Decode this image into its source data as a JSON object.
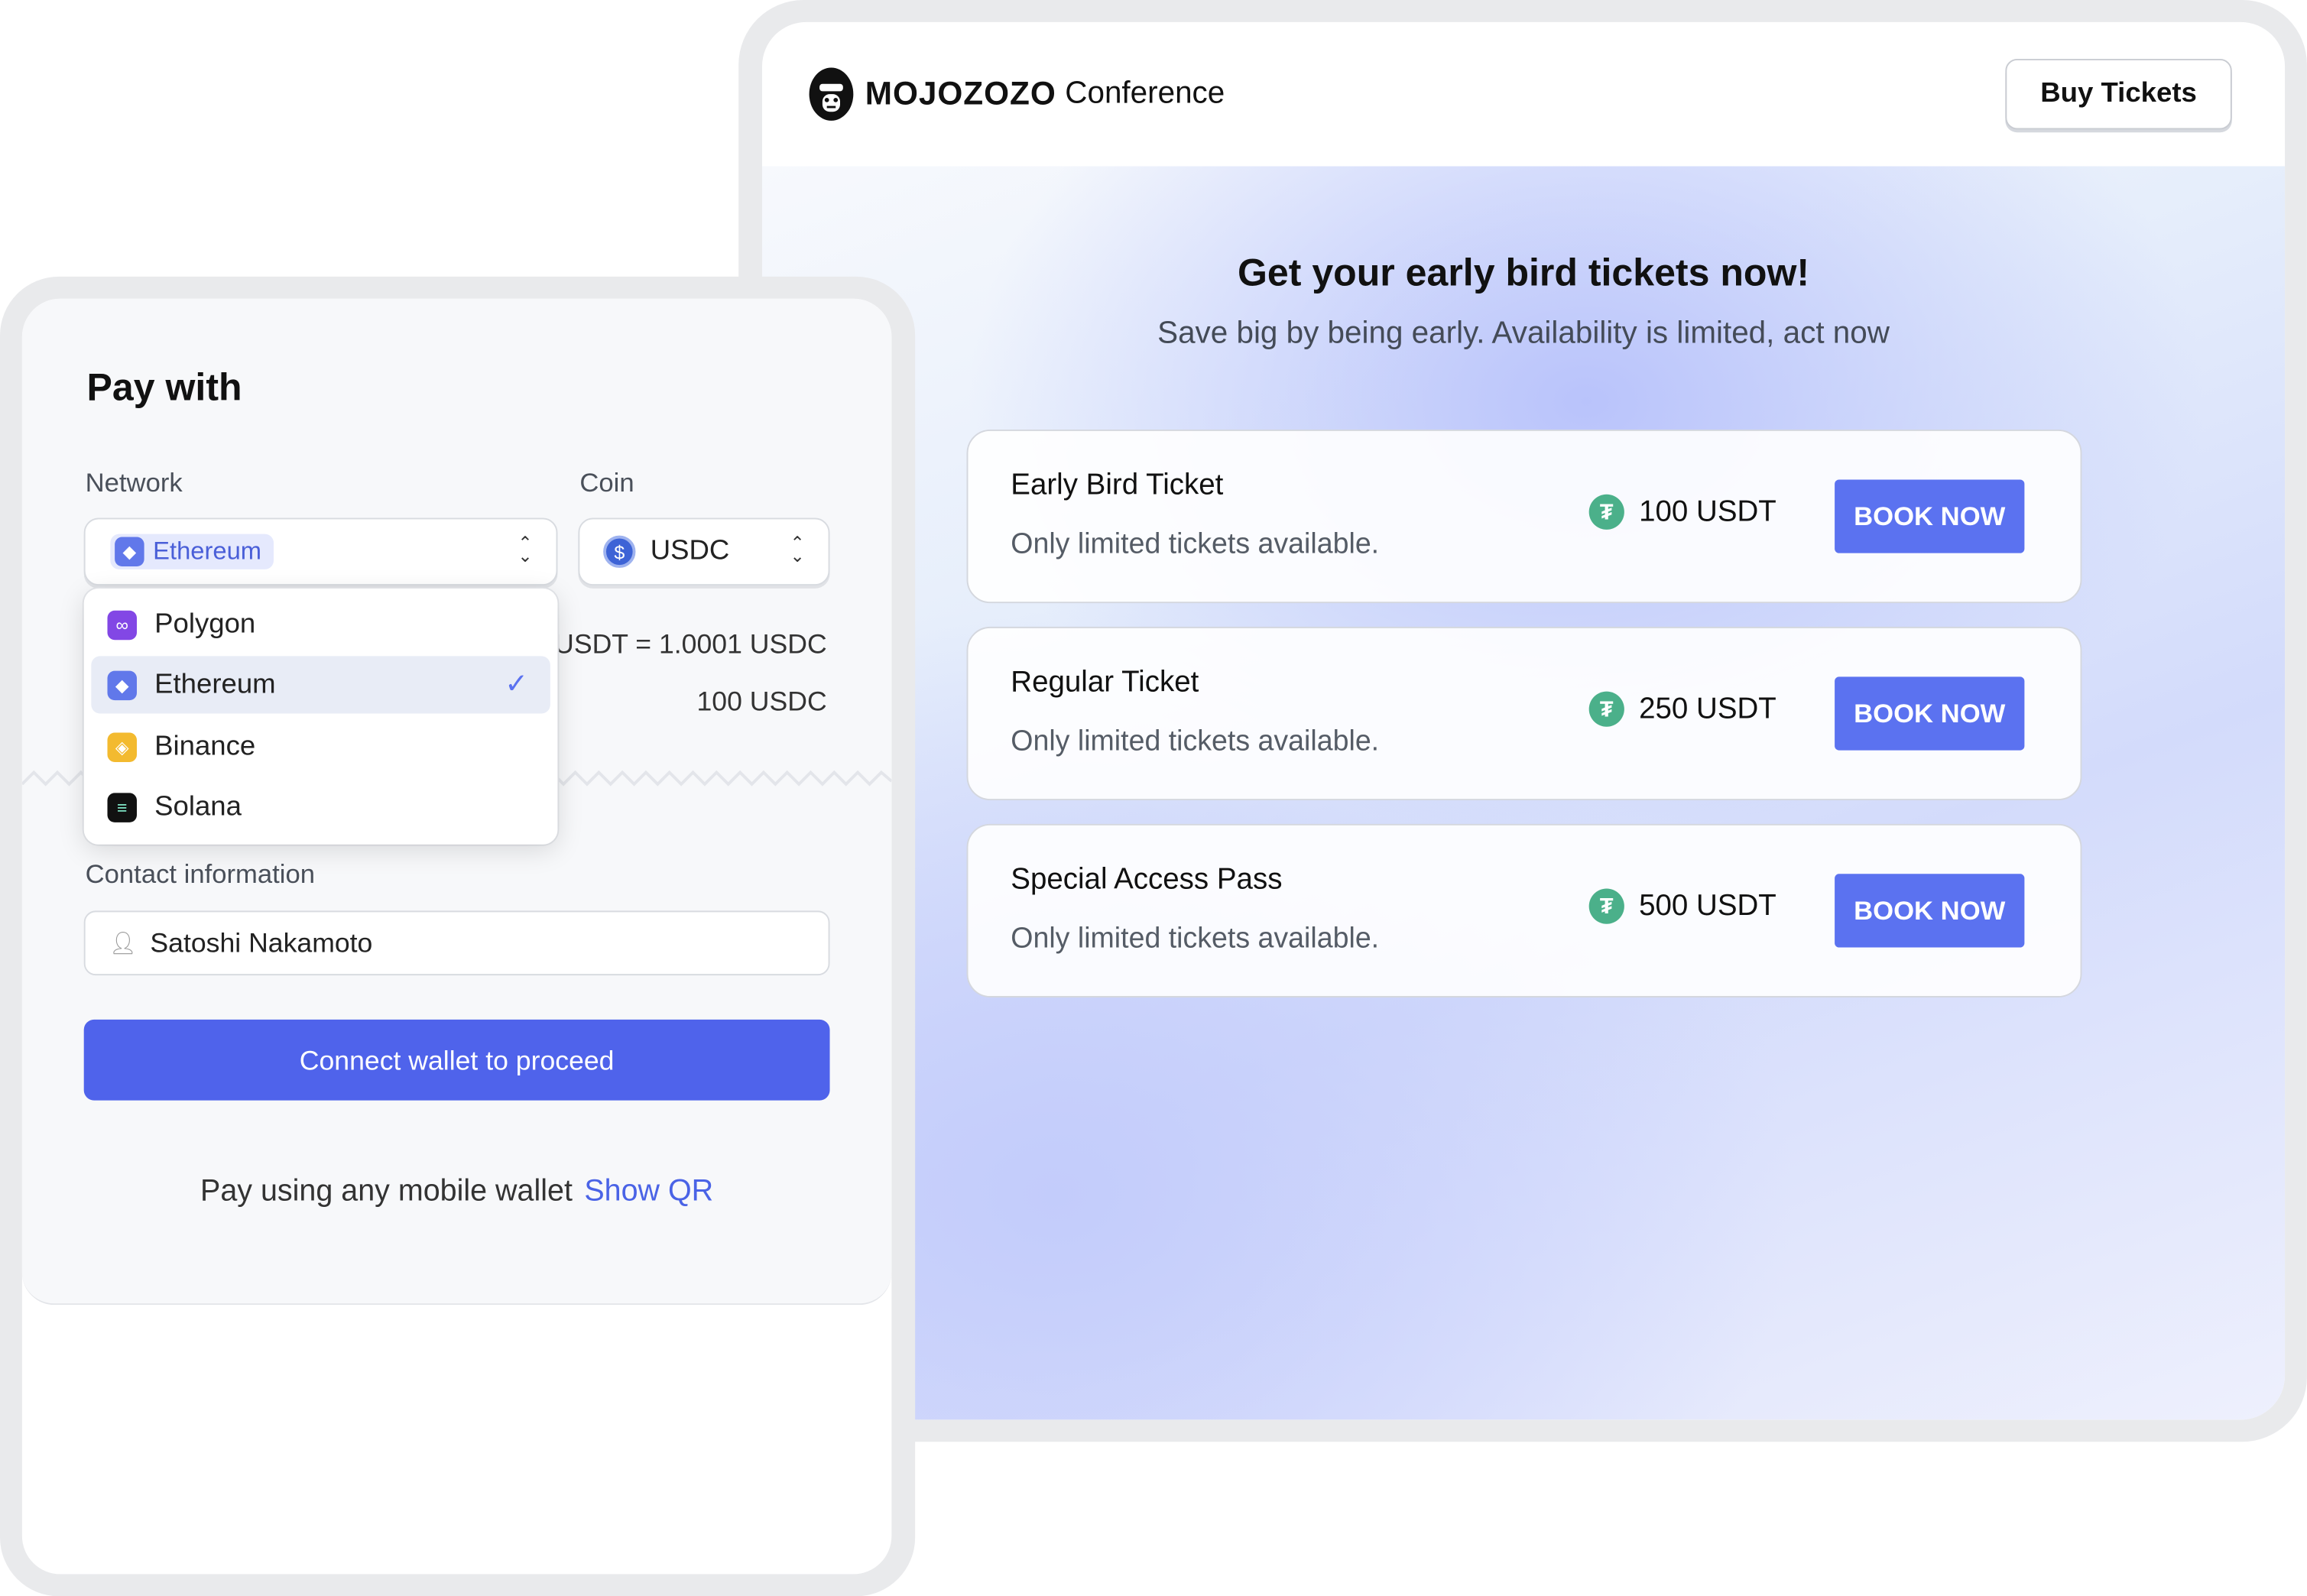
{
  "conference": {
    "brand": "MOJOZOZO",
    "brand_suffix": "Conference",
    "buy_tickets_label": "Buy Tickets",
    "hero_title": "Get your early bird tickets now!",
    "hero_subtitle": "Save big by being early. Availability is limited, act now",
    "tickets": [
      {
        "name": "Early Bird Ticket",
        "description": "Only limited tickets available.",
        "price": "100 USDT",
        "button": "BOOK NOW"
      },
      {
        "name": "Regular Ticket",
        "description": "Only limited tickets available.",
        "price": "250 USDT",
        "button": "BOOK NOW"
      },
      {
        "name": "Special Access Pass",
        "description": "Only limited tickets available.",
        "price": "500 USDT",
        "button": "BOOK NOW"
      }
    ],
    "accent_color": "#5b72f0"
  },
  "payment": {
    "title": "Pay with",
    "network_label": "Network",
    "network_selected": "Ethereum",
    "coin_label": "Coin",
    "coin_selected": "USDC",
    "rate": "USDT = 1.0001 USDC",
    "amount": "100 USDC",
    "network_options": [
      {
        "label": "Polygon",
        "icon": "polygon-icon",
        "color": "#8247e5"
      },
      {
        "label": "Ethereum",
        "icon": "ethereum-icon",
        "color": "#6178ea",
        "selected": true
      },
      {
        "label": "Binance",
        "icon": "binance-icon",
        "color": "#f3ba2f"
      },
      {
        "label": "Solana",
        "icon": "solana-icon",
        "color": "#111111"
      }
    ],
    "contact_label": "Contact information",
    "contact_value": "Satoshi Nakamoto",
    "connect_label": "Connect wallet to proceed",
    "mobile_text": "Pay using any mobile wallet",
    "show_qr_label": "Show QR",
    "primary_color": "#4f63eb"
  }
}
